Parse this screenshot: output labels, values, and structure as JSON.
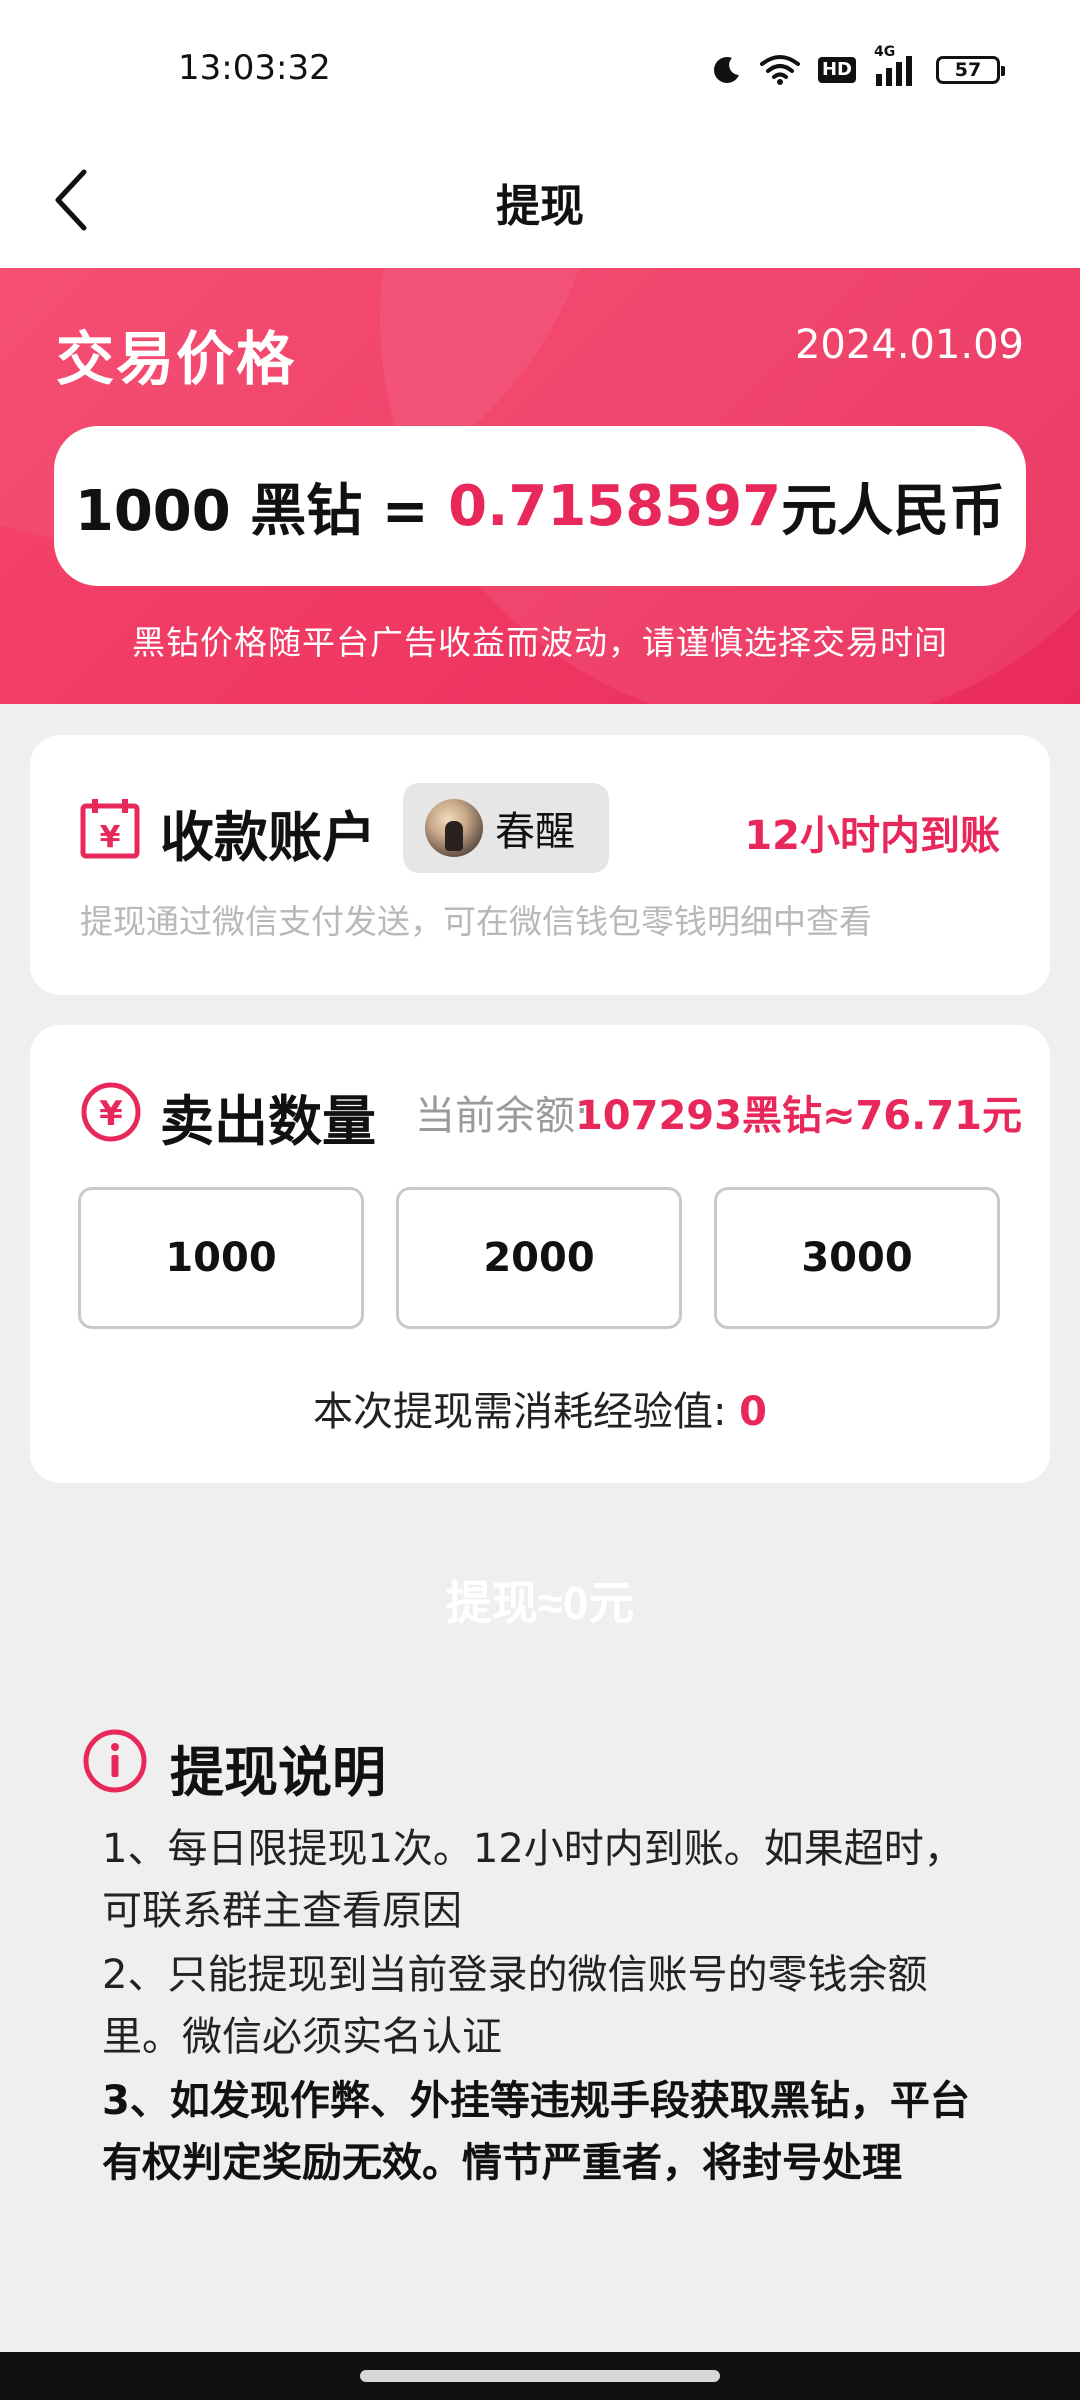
{
  "status_bar": {
    "time": "13:03:32",
    "hd": "HD",
    "network": "4G",
    "battery": "57",
    "icons": [
      "moon-icon",
      "wifi-icon",
      "hd-icon",
      "signal-icon",
      "battery-icon"
    ]
  },
  "nav": {
    "title": "提现",
    "back_icon": "chevron-left-icon"
  },
  "price": {
    "title": "交易价格",
    "date": "2024.01.09",
    "rate_left": "1000 黑钻 = ",
    "rate_value": "0.7158597",
    "rate_right": "元人民币",
    "note": "黑钻价格随平台广告收益而波动，请谨慎选择交易时间"
  },
  "account": {
    "heading": "收款账户",
    "icon": "calendar-yuan-icon",
    "name": "春醒",
    "arrival": "12小时内到账",
    "desc": "提现通过微信支付发送，可在微信钱包零钱明细中查看"
  },
  "sell": {
    "heading": "卖出数量",
    "icon": "yuan-circle-icon",
    "balance_label": "当前余额: ",
    "balance_value": "107293黑钻≈76.71元",
    "amounts": [
      "1000",
      "2000",
      "3000"
    ],
    "exp_label": "本次提现需消耗经验值: ",
    "exp_value": "0"
  },
  "withdraw_button": "提现≈0元",
  "info": {
    "title": "提现说明",
    "icon": "info-circle-icon",
    "items": [
      "1、每日限提现1次。12小时内到账。如果超时，可联系群主查看原因",
      "2、只能提现到当前登录的微信账号的零钱余额里。微信必须实名认证",
      "3、如发现作弊、外挂等违规手段获取黑钻，平台有权判定奖励无效。情节严重者，将封号处理"
    ]
  },
  "colors": {
    "accent": "#e8285a",
    "header_gradient_start": "#f5466b",
    "header_gradient_end": "#ea2b5a",
    "background": "#efefef"
  }
}
